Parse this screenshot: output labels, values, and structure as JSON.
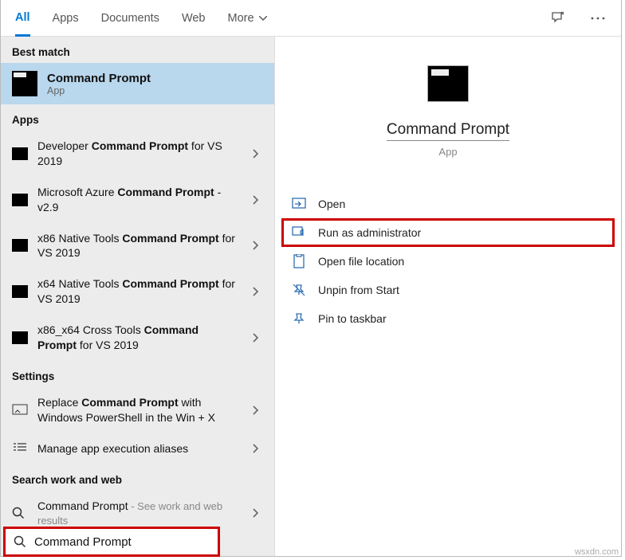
{
  "tabs": {
    "all": "All",
    "apps": "Apps",
    "documents": "Documents",
    "web": "Web",
    "more": "More"
  },
  "sections": {
    "best_match": "Best match",
    "apps": "Apps",
    "settings": "Settings",
    "search_web": "Search work and web"
  },
  "best_match": {
    "title": "Command Prompt",
    "subtitle": "App"
  },
  "apps_list": [
    {
      "prefix": "Developer ",
      "bold": "Command Prompt",
      "suffix": " for VS 2019"
    },
    {
      "prefix": "Microsoft Azure ",
      "bold": "Command Prompt",
      "suffix": " - v2.9"
    },
    {
      "prefix": "x86 Native Tools ",
      "bold": "Command Prompt",
      "suffix": " for VS 2019"
    },
    {
      "prefix": "x64 Native Tools ",
      "bold": "Command Prompt",
      "suffix": " for VS 2019"
    },
    {
      "prefix": "x86_x64 Cross Tools ",
      "bold": "Command Prompt",
      "suffix": " for VS 2019"
    }
  ],
  "settings_list": [
    {
      "prefix": "Replace ",
      "bold": "Command Prompt",
      "suffix": " with Windows PowerShell in the Win + X"
    },
    {
      "prefix": "Manage app execution aliases",
      "bold": "",
      "suffix": ""
    }
  ],
  "web_list": [
    {
      "text": "Command Prompt",
      "hint": " - See work and web results"
    }
  ],
  "preview": {
    "title": "Command Prompt",
    "subtitle": "App"
  },
  "actions": {
    "open": "Open",
    "run_admin": "Run as administrator",
    "open_loc": "Open file location",
    "unpin_start": "Unpin from Start",
    "pin_taskbar": "Pin to taskbar"
  },
  "search": {
    "value": "Command Prompt"
  },
  "watermark": "wsxdn.com"
}
